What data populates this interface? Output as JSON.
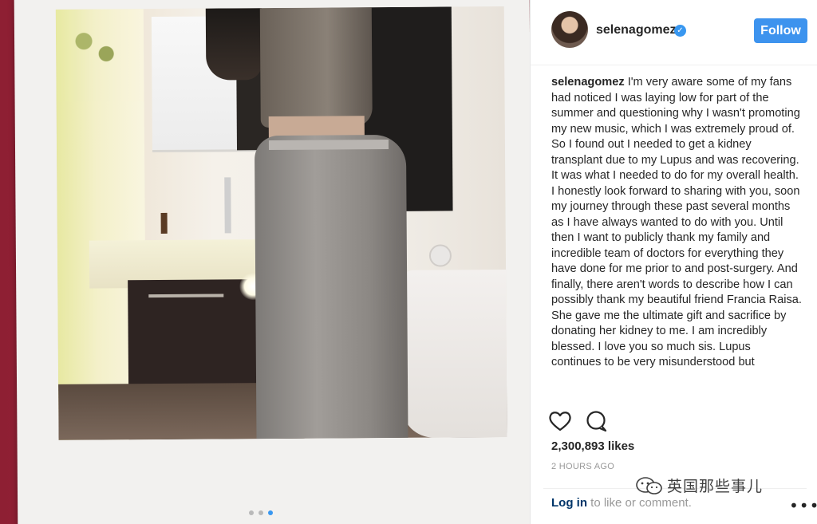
{
  "post": {
    "username": "selenagomez",
    "follow_label": "Follow",
    "caption_username": "selenagomez",
    "caption_text": " I'm very aware some of my fans had noticed I was laying low for part of the summer and questioning why I wasn't promoting my new music, which I was extremely proud of. So I found out I needed to get a kidney transplant due to my Lupus and was recovering. It was what I needed to do for my overall health. I honestly look forward to sharing with you, soon my journey through these past several months as I have always wanted to do with you. Until then I want to publicly thank my family and incredible team of doctors for everything they have done for me prior to and post-surgery. And finally, there aren't words to describe how I can possibly thank my beautiful friend Francia Raisa. She gave me the ultimate gift and sacrifice by donating her kidney to me. I am incredibly blessed. I love you so much sis. Lupus continues to be very misunderstood but",
    "likes": "2,300,893 likes",
    "timestamp": "2 HOURS AGO",
    "login_link": "Log in",
    "login_rest": " to like or comment.",
    "more": "•••"
  },
  "carousel": {
    "count": 3,
    "active_index": 2
  },
  "watermark": {
    "text": "英国那些事儿"
  },
  "icons": {
    "verified": "verified-badge-icon",
    "like": "heart-icon",
    "comment": "comment-bubble-icon",
    "more": "more-options-icon",
    "watermark": "wechat-icon"
  },
  "colors": {
    "follow_bg": "#3d93ee",
    "verified": "#3897f0",
    "text": "#262626",
    "muted": "#999999",
    "link": "#003569",
    "backdrop": "#a52840"
  }
}
